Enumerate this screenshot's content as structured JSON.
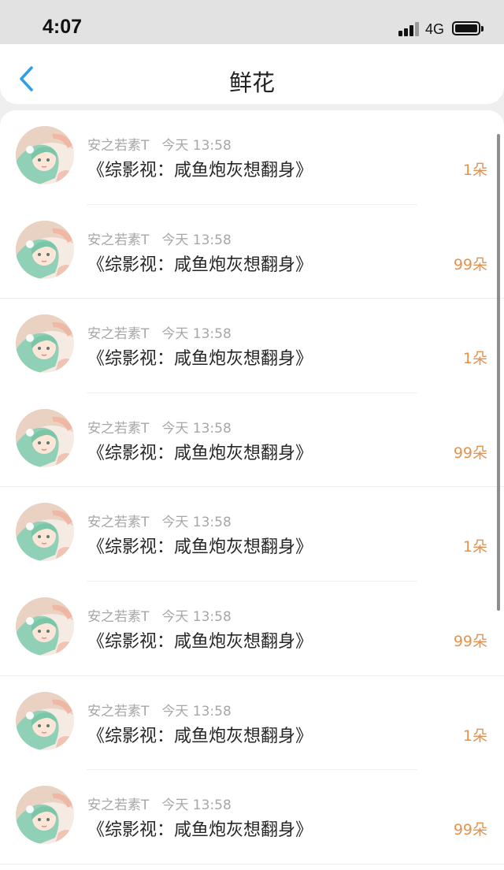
{
  "status_bar": {
    "time": "4:07",
    "network": "4G"
  },
  "nav": {
    "title": "鲜花",
    "back_icon": "chevron-left-icon"
  },
  "colors": {
    "accent": "#2f9ee8",
    "count": "#e4934f",
    "meta": "#a7a7a7"
  },
  "flowers": [
    {
      "user": "安之若素T",
      "time": "今天 13:58",
      "book": "《综影视：咸鱼炮灰想翻身》",
      "count": "1朵"
    },
    {
      "user": "安之若素T",
      "time": "今天 13:58",
      "book": "《综影视：咸鱼炮灰想翻身》",
      "count": "99朵"
    },
    {
      "user": "安之若素T",
      "time": "今天 13:58",
      "book": "《综影视：咸鱼炮灰想翻身》",
      "count": "1朵"
    },
    {
      "user": "安之若素T",
      "time": "今天 13:58",
      "book": "《综影视：咸鱼炮灰想翻身》",
      "count": "99朵"
    },
    {
      "user": "安之若素T",
      "time": "今天 13:58",
      "book": "《综影视：咸鱼炮灰想翻身》",
      "count": "1朵"
    },
    {
      "user": "安之若素T",
      "time": "今天 13:58",
      "book": "《综影视：咸鱼炮灰想翻身》",
      "count": "99朵"
    },
    {
      "user": "安之若素T",
      "time": "今天 13:58",
      "book": "《综影视：咸鱼炮灰想翻身》",
      "count": "1朵"
    },
    {
      "user": "安之若素T",
      "time": "今天 13:58",
      "book": "《综影视：咸鱼炮灰想翻身》",
      "count": "99朵"
    }
  ]
}
